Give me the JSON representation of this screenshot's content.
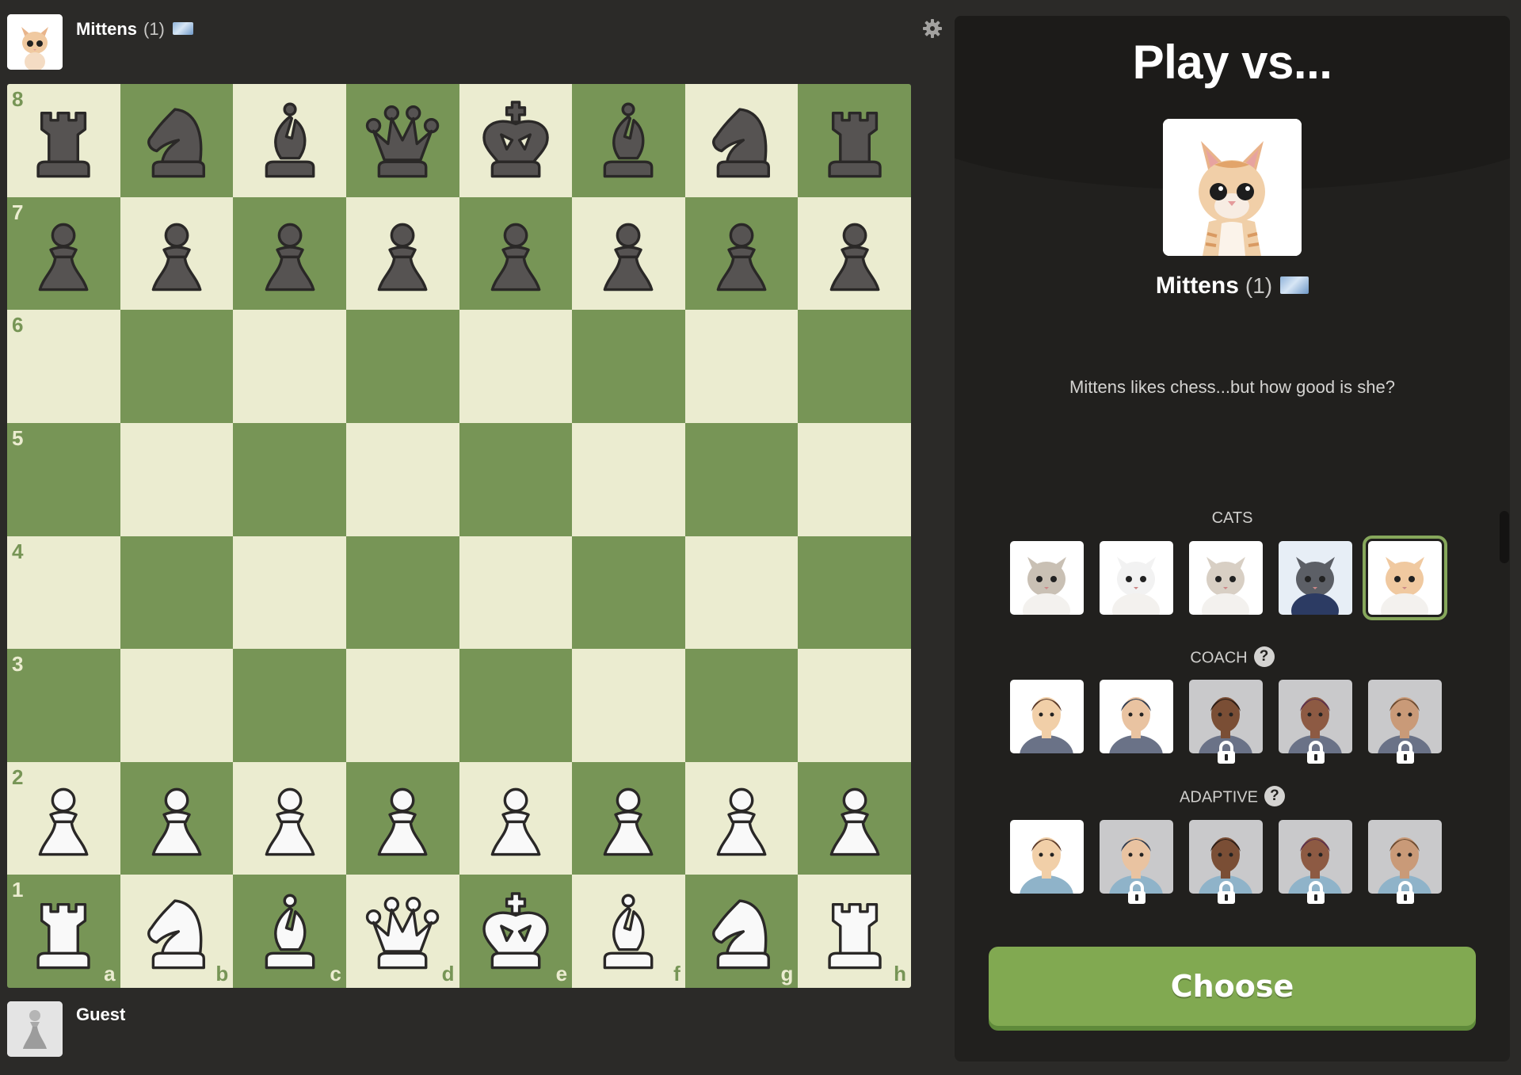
{
  "top_player": {
    "name": "Mittens",
    "rating": "(1)",
    "flag": "international-flag",
    "avatar": "mittens-kitten"
  },
  "bottom_player": {
    "name": "Guest",
    "avatar": "default-pawn-avatar"
  },
  "board": {
    "light_color": "#ebecd0",
    "dark_color": "#779556",
    "ranks": [
      "8",
      "7",
      "6",
      "5",
      "4",
      "3",
      "2",
      "1"
    ],
    "files": [
      "a",
      "b",
      "c",
      "d",
      "e",
      "f",
      "g",
      "h"
    ],
    "position": [
      [
        "bR",
        "bN",
        "bB",
        "bQ",
        "bK",
        "bB",
        "bN",
        "bR"
      ],
      [
        "bP",
        "bP",
        "bP",
        "bP",
        "bP",
        "bP",
        "bP",
        "bP"
      ],
      [
        "",
        "",
        "",
        "",
        "",
        "",
        "",
        ""
      ],
      [
        "",
        "",
        "",
        "",
        "",
        "",
        "",
        ""
      ],
      [
        "",
        "",
        "",
        "",
        "",
        "",
        "",
        ""
      ],
      [
        "",
        "",
        "",
        "",
        "",
        "",
        "",
        ""
      ],
      [
        "wP",
        "wP",
        "wP",
        "wP",
        "wP",
        "wP",
        "wP",
        "wP"
      ],
      [
        "wR",
        "wN",
        "wB",
        "wQ",
        "wK",
        "wB",
        "wN",
        "wR"
      ]
    ]
  },
  "settings": {
    "icon": "gear-icon"
  },
  "panel": {
    "title": "Play vs...",
    "selected_bot": {
      "name": "Mittens",
      "rating": "(1)",
      "flag": "international-flag",
      "description": "Mittens likes chess...but how good is she?"
    },
    "sections": [
      {
        "label": "CATS",
        "has_help": false,
        "bots": [
          {
            "name": "cat-1",
            "locked": false,
            "selected": false,
            "bg": "#ffffff"
          },
          {
            "name": "cat-2",
            "locked": false,
            "selected": false,
            "bg": "#ffffff"
          },
          {
            "name": "cat-3",
            "locked": false,
            "selected": false,
            "bg": "#ffffff"
          },
          {
            "name": "cat-4",
            "locked": false,
            "selected": false,
            "bg": "#e7eef6"
          },
          {
            "name": "mittens",
            "locked": false,
            "selected": true,
            "bg": "#ffffff"
          }
        ]
      },
      {
        "label": "COACH",
        "has_help": true,
        "bots": [
          {
            "name": "coach-1",
            "locked": false,
            "selected": false,
            "bg": "#ffffff"
          },
          {
            "name": "coach-2",
            "locked": false,
            "selected": false,
            "bg": "#ffffff"
          },
          {
            "name": "coach-3",
            "locked": true,
            "selected": false,
            "bg": "#c9c9cb"
          },
          {
            "name": "coach-4",
            "locked": true,
            "selected": false,
            "bg": "#c9c9cb"
          },
          {
            "name": "coach-5",
            "locked": true,
            "selected": false,
            "bg": "#c9c9cb"
          }
        ]
      },
      {
        "label": "ADAPTIVE",
        "has_help": true,
        "bots": [
          {
            "name": "adaptive-1",
            "locked": false,
            "selected": false,
            "bg": "#ffffff"
          },
          {
            "name": "adaptive-2",
            "locked": true,
            "selected": false,
            "bg": "#c9c9cb"
          },
          {
            "name": "adaptive-3",
            "locked": true,
            "selected": false,
            "bg": "#c9c9cb"
          },
          {
            "name": "adaptive-4",
            "locked": true,
            "selected": false,
            "bg": "#c9c9cb"
          },
          {
            "name": "adaptive-5",
            "locked": true,
            "selected": false,
            "bg": "#c9c9cb"
          }
        ]
      }
    ],
    "help_glyph": "?",
    "choose_label": "Choose",
    "accent_color": "#81a951"
  }
}
